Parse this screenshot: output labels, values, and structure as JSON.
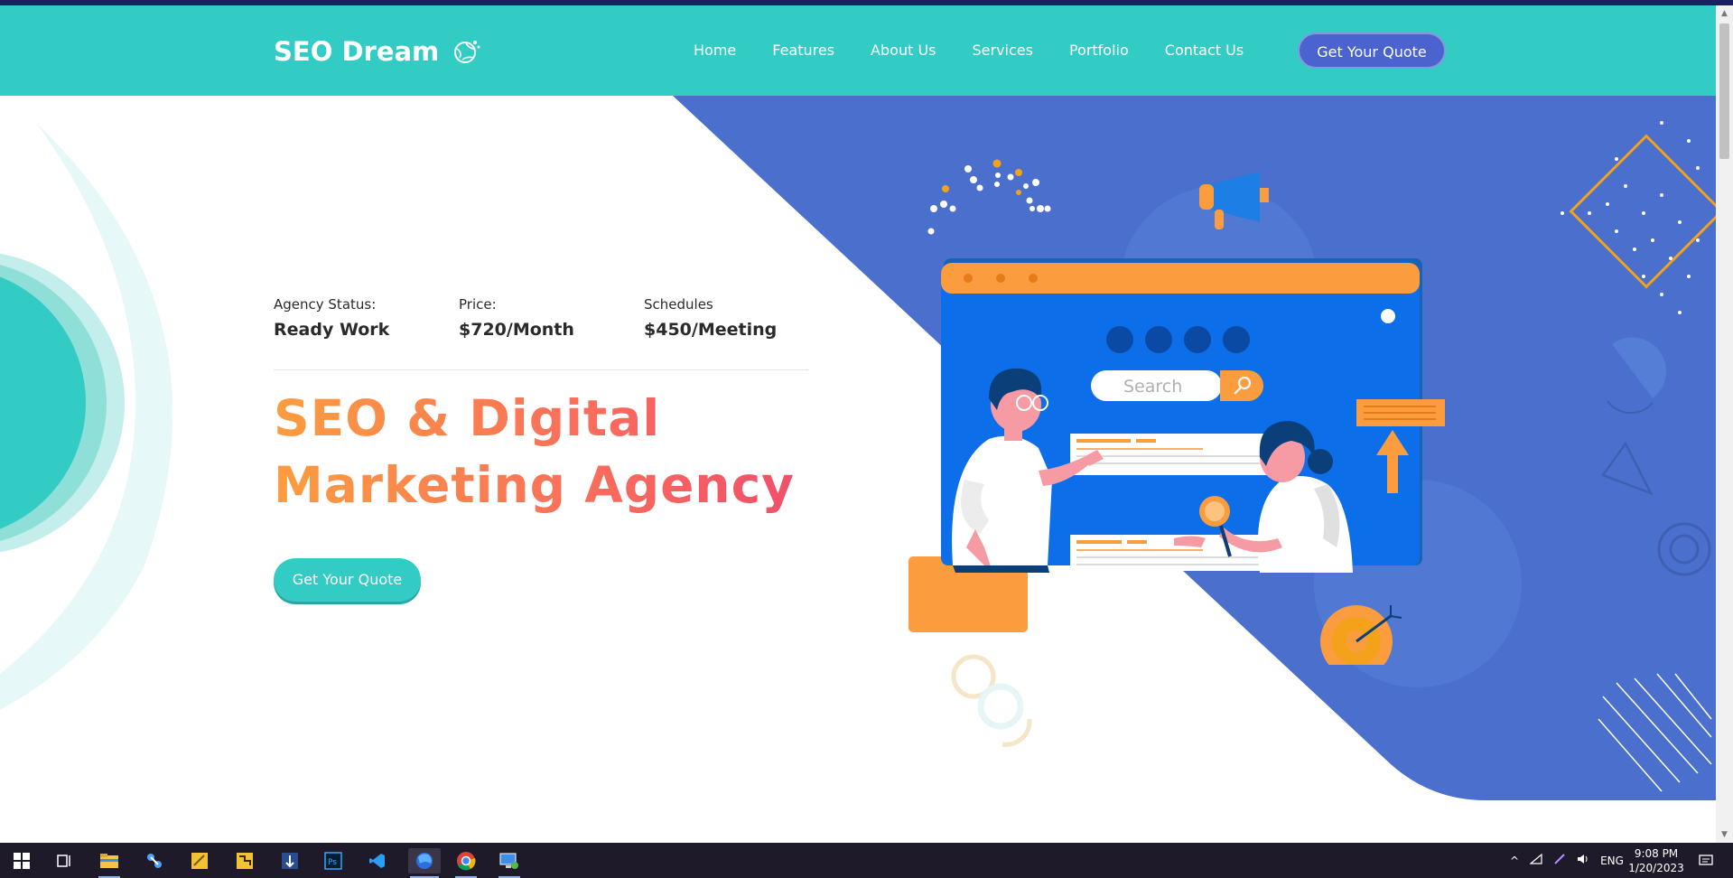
{
  "brand": {
    "name": "SEO Dream"
  },
  "nav": {
    "items": [
      "Home",
      "Features",
      "About Us",
      "Services",
      "Portfolio",
      "Contact Us"
    ],
    "cta": "Get Your Quote"
  },
  "hero": {
    "stats": [
      {
        "label": "Agency Status:",
        "value": "Ready Work"
      },
      {
        "label": "Price:",
        "value": "$720/Month"
      },
      {
        "label": "Schedules",
        "value": "$450/Meeting"
      }
    ],
    "headline_line1": "SEO & Digital",
    "headline_line2": "Marketing Agency",
    "cta": "Get Your Quote",
    "search_placeholder": "Search"
  },
  "colors": {
    "teal": "#33ccc5",
    "blue": "#4a6fcc",
    "orange": "#fb9d3f",
    "pink": "#f0506a"
  },
  "taskbar": {
    "apps": [
      "windows-start-icon",
      "task-view-icon",
      "file-explorer-icon",
      "app-icon",
      "sticky-app-icon",
      "tool-app-icon",
      "git-app-icon",
      "photoshop-icon",
      "vscode-icon",
      "firefox-icon",
      "chrome-icon",
      "remote-desktop-icon"
    ],
    "language": "ENG",
    "time": "9:08 PM",
    "date": "1/20/2023"
  }
}
